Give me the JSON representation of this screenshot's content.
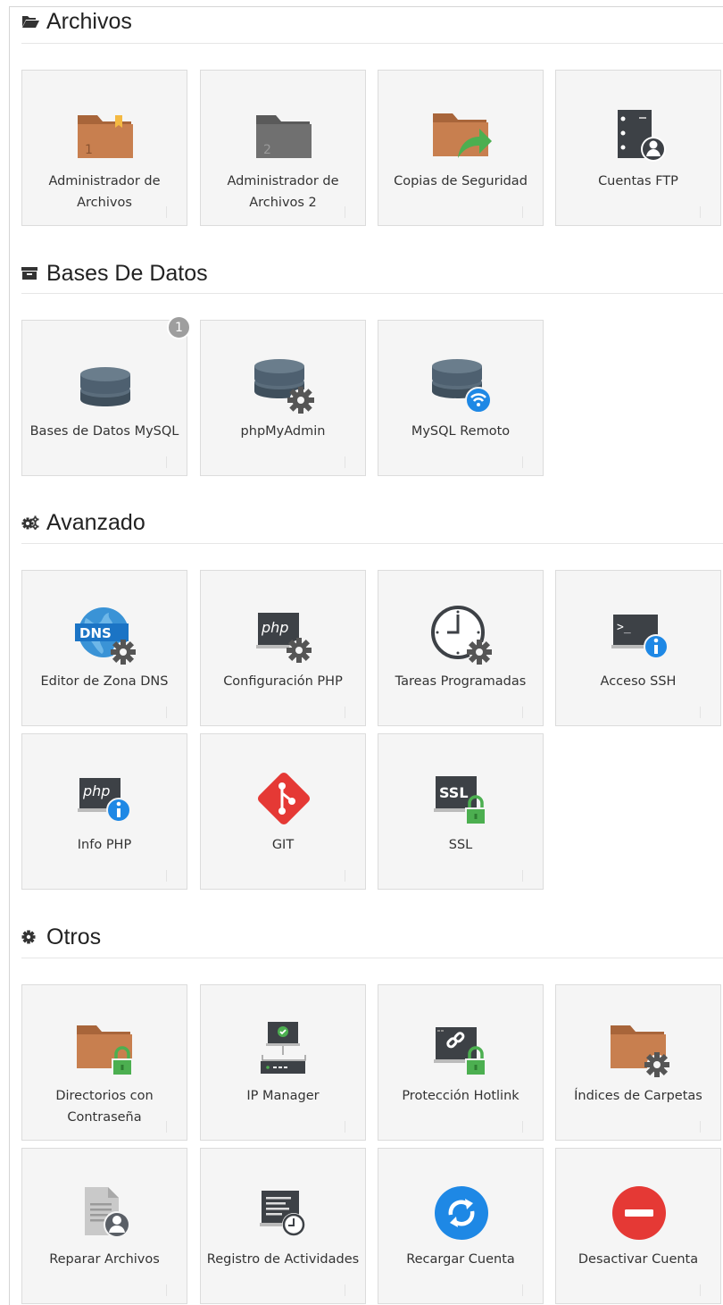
{
  "sections": [
    {
      "title": "Archivos",
      "icon": "folder-open-icon",
      "tiles": [
        {
          "label": "Administrador de Archivos",
          "icon": "file-manager-icon"
        },
        {
          "label": "Administrador de Archivos 2",
          "icon": "file-manager-2-icon"
        },
        {
          "label": "Copias de Seguridad",
          "icon": "backup-folder-icon"
        },
        {
          "label": "Cuentas FTP",
          "icon": "ftp-accounts-icon"
        }
      ]
    },
    {
      "title": "Bases De Datos",
      "icon": "archive-box-icon",
      "tiles": [
        {
          "label": "Bases de Datos MySQL",
          "icon": "database-icon",
          "badge": "1"
        },
        {
          "label": "phpMyAdmin",
          "icon": "database-gear-icon"
        },
        {
          "label": "MySQL Remoto",
          "icon": "database-wifi-icon"
        }
      ]
    },
    {
      "title": "Avanzado",
      "icon": "cogs-icon",
      "tiles": [
        {
          "label": "Editor de Zona DNS",
          "icon": "dns-globe-gear-icon"
        },
        {
          "label": "Configuración PHP",
          "icon": "php-gear-icon"
        },
        {
          "label": "Tareas Programadas",
          "icon": "clock-gear-icon"
        },
        {
          "label": "Acceso SSH",
          "icon": "terminal-info-icon"
        },
        {
          "label": "Info PHP",
          "icon": "php-info-icon"
        },
        {
          "label": "GIT",
          "icon": "git-icon"
        },
        {
          "label": "SSL",
          "icon": "ssl-lock-icon"
        }
      ]
    },
    {
      "title": "Otros",
      "icon": "gear-icon",
      "tiles": [
        {
          "label": "Directorios con Contraseña",
          "icon": "folder-lock-icon"
        },
        {
          "label": "IP Manager",
          "icon": "ip-manager-icon"
        },
        {
          "label": "Protección Hotlink",
          "icon": "hotlink-lock-icon"
        },
        {
          "label": "Índices de Carpetas",
          "icon": "folder-gear-icon"
        },
        {
          "label": "Reparar Archivos",
          "icon": "document-user-icon"
        },
        {
          "label": "Registro de Actividades",
          "icon": "activity-log-icon"
        },
        {
          "label": "Recargar Cuenta",
          "icon": "refresh-icon"
        },
        {
          "label": "Desactivar Cuenta",
          "icon": "no-entry-icon"
        }
      ]
    }
  ],
  "colors": {
    "folder": "#c87f4f",
    "folder_dark": "#a8653a",
    "db": "#4e6070",
    "green": "#4caf50",
    "blue": "#1e88e5",
    "red": "#e53935",
    "dark": "#3d4146"
  }
}
